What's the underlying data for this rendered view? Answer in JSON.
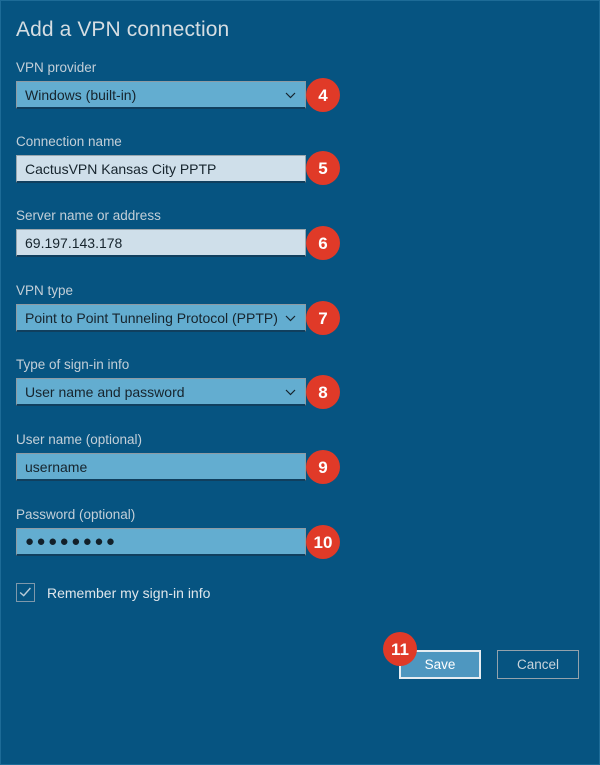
{
  "page": {
    "title": "Add a VPN connection",
    "background_color": "#065481",
    "accent_badge_color": "#e03a28"
  },
  "fields": [
    {
      "label": "VPN provider",
      "value": "Windows (built-in)",
      "kind": "dropdown",
      "badge": "4",
      "name": "vpn-provider"
    },
    {
      "label": "Connection name",
      "value": "CactusVPN Kansas City PPTP",
      "kind": "text",
      "badge": "5",
      "name": "connection-name"
    },
    {
      "label": "Server name or address",
      "value": "69.197.143.178",
      "kind": "text",
      "badge": "6",
      "name": "server-address"
    },
    {
      "label": "VPN type",
      "value": "Point to Point Tunneling Protocol (PPTP)",
      "kind": "dropdown",
      "badge": "7",
      "name": "vpn-type"
    },
    {
      "label": "Type of sign-in info",
      "value": "User name and password",
      "kind": "dropdown",
      "badge": "8",
      "name": "signin-type"
    },
    {
      "label": "User name (optional)",
      "value": "username",
      "kind": "blue-text",
      "badge": "9",
      "name": "user-name"
    },
    {
      "label": "Password (optional)",
      "value": "●●●●●●●●",
      "kind": "password",
      "badge": "10",
      "name": "password"
    }
  ],
  "checkbox": {
    "label": "Remember my sign-in info",
    "checked": true
  },
  "buttons": {
    "save_label": "Save",
    "cancel_label": "Cancel",
    "save_badge": "11"
  }
}
